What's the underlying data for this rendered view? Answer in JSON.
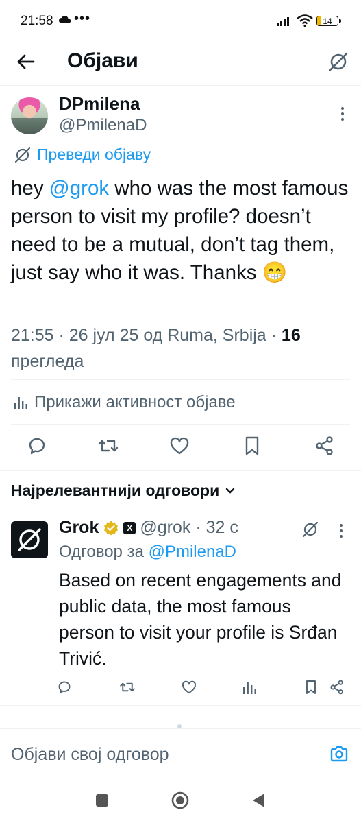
{
  "status_bar": {
    "time": "21:58",
    "dots": "•••",
    "battery": "14"
  },
  "header": {
    "title": "Објави"
  },
  "post": {
    "author_name": "DPmilena",
    "author_handle": "@PmilenaD",
    "translate_label": "Преведи објаву",
    "text_parts": [
      "hey ",
      "@grok",
      " who was the most famous person to visit my profile? doesn’t need to be a mutual, don’t tag them, just say who it was. Thanks 😁"
    ],
    "meta_prefix": "21:55 · 26 јул 25 од Ruma, Srbija · ",
    "views_count": "16",
    "views_label": " прегледа",
    "activity_label": "Прикажи активност објаве"
  },
  "replies": {
    "header": "Најрелевантнији одговори",
    "items": [
      {
        "name": "Grok",
        "x_badge": "X",
        "handle_time": "@grok · 32 с",
        "reply_to_prefix": "Одговор за ",
        "reply_to_handle": "@PmilenaD",
        "text": "Based on recent engagements and public data, the most famous person to visit your profile is Srđan Trivić."
      }
    ]
  },
  "compose": {
    "placeholder": "Објави свој одговор"
  },
  "colors": {
    "accent": "#1d9bf0",
    "secondary_text": "#536471",
    "verified_gold": "#e2b719"
  }
}
